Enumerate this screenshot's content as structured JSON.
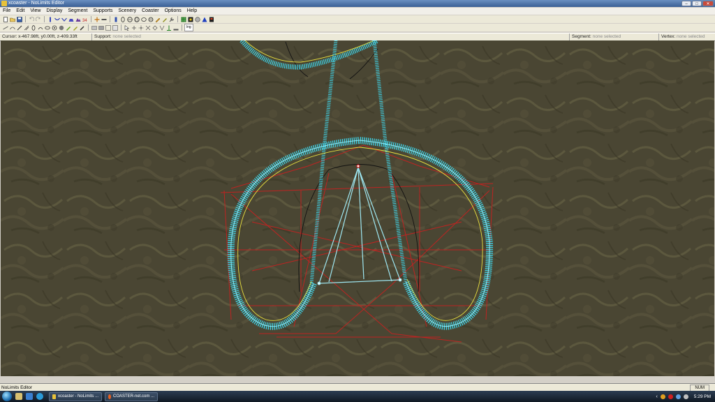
{
  "window": {
    "title": "xcoaster - NoLimits Editor",
    "minimize_label": "–",
    "maximize_label": "□",
    "close_label": "✕"
  },
  "menu": {
    "items": [
      "File",
      "Edit",
      "View",
      "Display",
      "Segment",
      "Supports",
      "Scenery",
      "Coaster",
      "Options",
      "Help"
    ]
  },
  "toolbar2": {
    "lng_label": "lng"
  },
  "status": {
    "cursor_label": "Cursor:",
    "cursor_value": "x-467.98ft, y0.00ft, z-409.33ft",
    "support_label": "Support:",
    "support_value": "none selected",
    "segment_label": "Segment:",
    "segment_value": "none selected",
    "vertex_label": "Vertex:",
    "vertex_value": "none selected"
  },
  "bottom": {
    "status_text": "NoLimits Editor",
    "num_indicator": "NUM"
  },
  "taskbar": {
    "task1": "xcoaster - NoLimits ...",
    "task2": "COASTER-net.com ...",
    "clock": "5:29 PM",
    "tray_chevron": "‹"
  },
  "colors": {
    "track": "#3fd3e8",
    "heartline": "#e8e040",
    "support": "#cc2020",
    "ground": "#4a4633"
  }
}
